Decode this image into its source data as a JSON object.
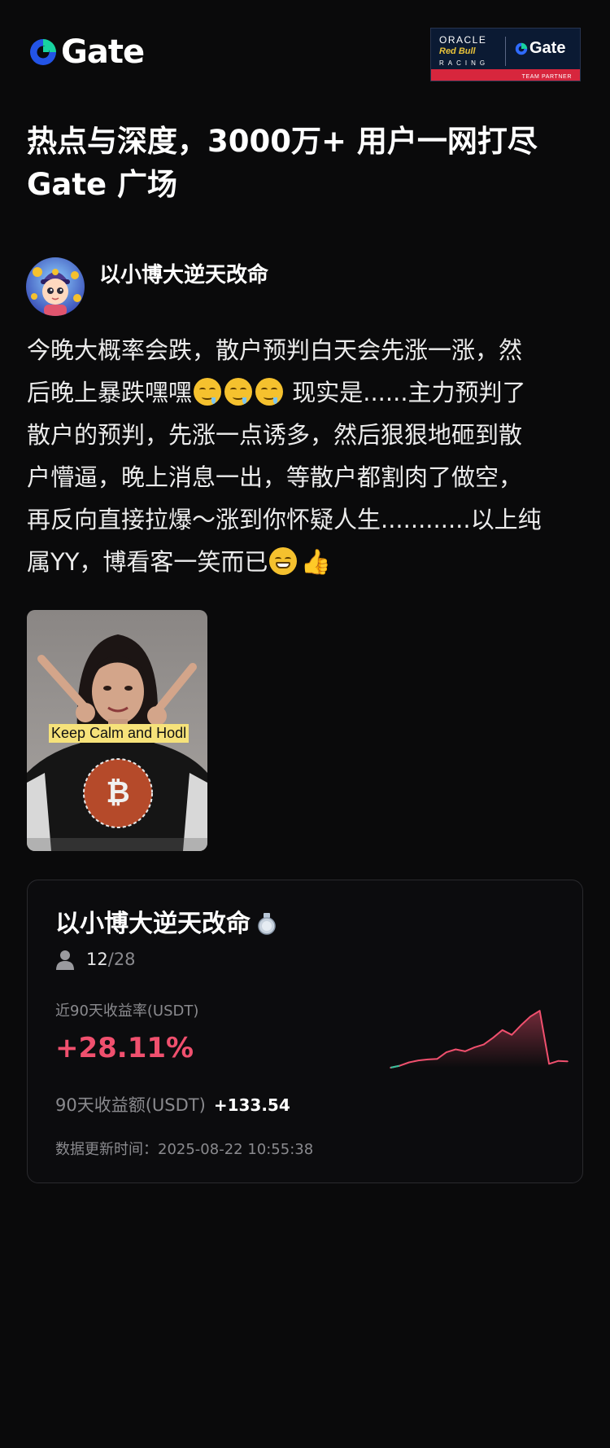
{
  "brand": {
    "name": "Gate",
    "accent": "#2354e6",
    "partner_badge": {
      "line1": "ORACLE",
      "line2": "Red Bull",
      "line3": "RACING",
      "gate": "Gate",
      "tag": "TEAM PARTNER"
    }
  },
  "headline": {
    "line1": "热点与深度，3000万+ 用户一网打尽",
    "line2": "Gate 广场"
  },
  "post": {
    "author": "以小博大逆天改命",
    "lines": [
      "今晚大概率会跌，散户预判白天会先涨一涨，然",
      "后晚上暴跌嘿嘿",
      " 现实是......主力预判了",
      "散户的预判，先涨一点诱多，然后狠狠地砸到散",
      "户懵逼，晚上消息一出，等散户都割肉了做空，",
      "再反向直接拉爆～涨到你怀疑人生............以上纯",
      "属YY，博看客一笑而已"
    ],
    "media_caption": "Keep Calm and Hodl",
    "emoji_icons": [
      "drooling-face-icon",
      "grin-icon",
      "thumbs-up-icon"
    ]
  },
  "card": {
    "name": "以小博大逆天改命",
    "badge_icon": "medal-icon",
    "followers": "12",
    "followers_sep": "/",
    "followers_total": "28",
    "roi_label": "近90天收益率(USDT)",
    "roi_value": "+28.11%",
    "roi_color": "#f0506e",
    "pnl_label": "90天收益额(USDT)",
    "pnl_value": "+133.54",
    "updated_label": "数据更新时间：",
    "updated_value": "2025-08-22 10:55:38"
  },
  "chart_data": {
    "type": "area",
    "title": "",
    "xlabel": "",
    "ylabel": "",
    "series": [
      {
        "values": [
          0.0,
          0.8,
          2.2,
          3.0,
          3.4,
          3.6,
          6.4,
          7.6,
          6.8,
          8.4,
          9.6,
          12.4,
          15.6,
          13.6,
          17.6,
          21.2,
          23.6,
          1.6,
          2.8,
          2.6
        ]
      }
    ],
    "ylim": [
      0,
      25
    ],
    "grid": false,
    "legend": "none",
    "colors": {
      "line": "#f0506e",
      "start": "#34c39c"
    }
  }
}
